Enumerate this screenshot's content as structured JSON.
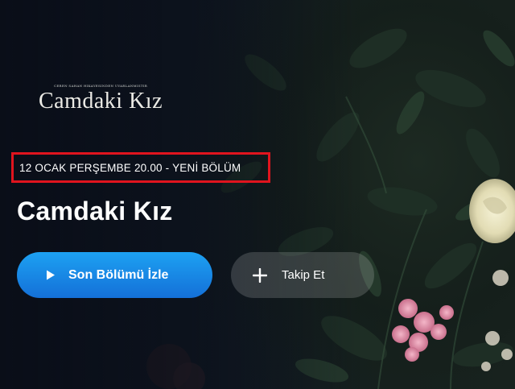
{
  "logo": {
    "subtitle": "CEREN SAHAN HIKAYESINDEN UYARLANMISTIR",
    "title": "Camdaki Kız"
  },
  "announcement": "12 OCAK PERŞEMBE 20.00 - YENİ BÖLÜM",
  "show_title": "Camdaki Kız",
  "buttons": {
    "play": {
      "label": "Son Bölümü İzle",
      "icon": "play-icon"
    },
    "follow": {
      "label": "Takip Et",
      "icon": "plus-icon"
    }
  },
  "colors": {
    "highlight_border": "#e0141e",
    "play_button": "#1a8fe8",
    "background": "#0e1420"
  }
}
